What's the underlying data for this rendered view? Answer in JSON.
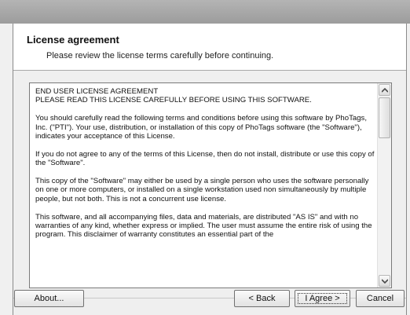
{
  "header": {
    "title": "License agreement",
    "subtitle": "Please review the license terms carefully before continuing."
  },
  "license": {
    "paragraphs": [
      "END USER LICENSE AGREEMENT",
      "PLEASE READ THIS LICENSE CAREFULLY BEFORE USING THIS SOFTWARE.",
      "You should carefully read the following terms and conditions before using this software by PhoTags, Inc. (\"PTI\").  Your use, distribution, or installation of this copy of PhoTags software (the \"Software\"), indicates your acceptance of this License.",
      "If you do not agree to any of the terms of this License, then do not install, distribute or use this copy of the \"Software\".",
      "This copy of the \"Software\" may either be used by a single person who uses the software personally on one or more computers, or installed on a single workstation used non simultaneously by multiple people, but not both. This is not a concurrent use license.",
      "This software, and all accompanying files, data and materials, are distributed \"AS IS\" and with no warranties of any kind, whether express or implied. The user must assume the entire risk of using the program.  This disclaimer of warranty constitutes an essential part of the"
    ]
  },
  "buttons": {
    "about": "About...",
    "back": "< Back",
    "agree": "I Agree >",
    "cancel": "Cancel"
  },
  "icons": {
    "scroll_up": "chevron-up-icon",
    "scroll_down": "chevron-down-icon"
  }
}
